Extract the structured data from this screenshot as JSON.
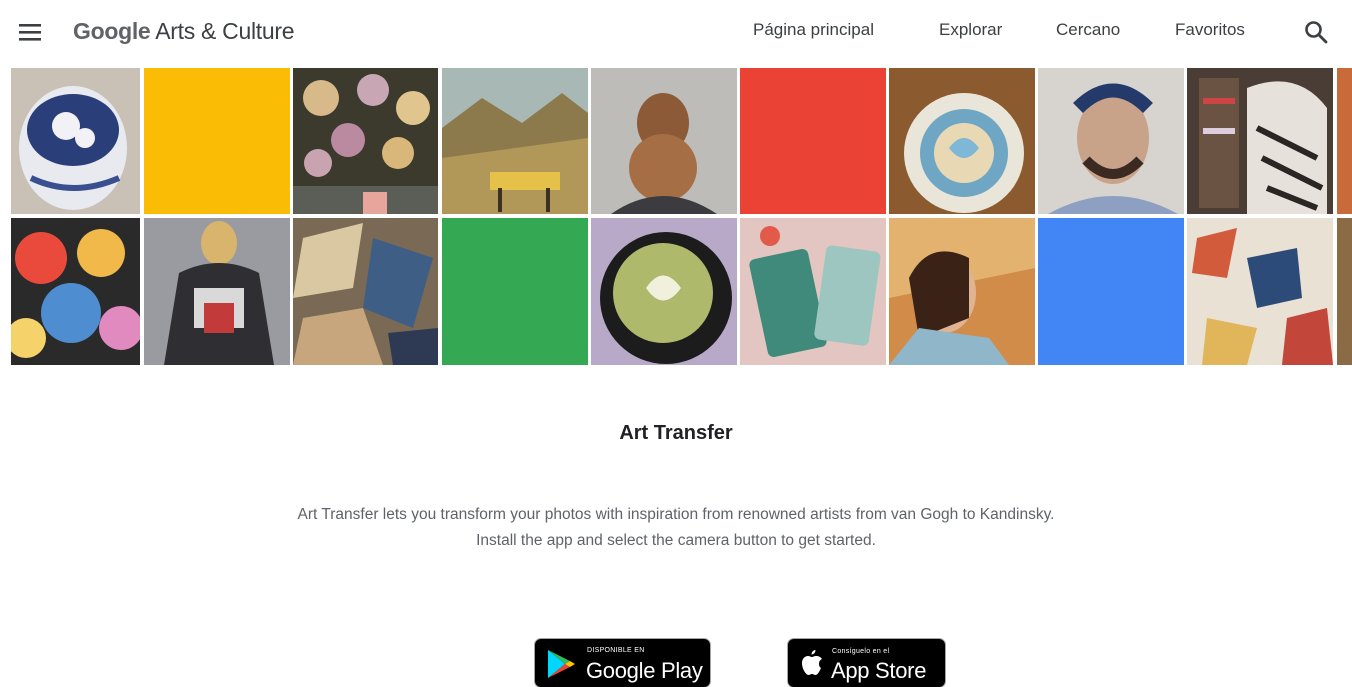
{
  "header": {
    "logo_google": "Google",
    "logo_rest": " Arts & Culture",
    "nav": [
      {
        "label": "Página principal"
      },
      {
        "label": "Explorar"
      },
      {
        "label": "Cercano"
      },
      {
        "label": "Favoritos"
      }
    ],
    "menu_icon": "hamburger-menu-icon",
    "search_icon": "search-icon"
  },
  "colors": {
    "yellow": "#fbbc05",
    "red": "#ea4335",
    "green": "#34a853",
    "blue": "#4285f4",
    "text_primary": "#202124",
    "text_secondary": "#5f6368"
  },
  "gallery": {
    "row1": [
      "blue-white porcelain photo",
      "yellow tile",
      "floral painting",
      "mountain landscape",
      "woman hair bun",
      "red tile",
      "latte art cup",
      "mosaic portrait",
      "woman scarf bookshelf"
    ],
    "row2": [
      "abstract faces",
      "woman denim jacket",
      "cubist painting",
      "green tile",
      "matcha latte",
      "phone cards",
      "impressionist selfie",
      "blue tile",
      "cubist collage"
    ]
  },
  "content": {
    "title": "Art Transfer",
    "description_line1": "Art Transfer lets you transform your photos with inspiration from renowned artists from van Gogh to Kandinsky.",
    "description_line2": "Install the app and select the camera button to get started."
  },
  "badges": {
    "google_play_small": "DISPONIBLE EN",
    "google_play_big": "Google Play",
    "app_store_small": "Consíguelo en el",
    "app_store_big": "App Store"
  }
}
